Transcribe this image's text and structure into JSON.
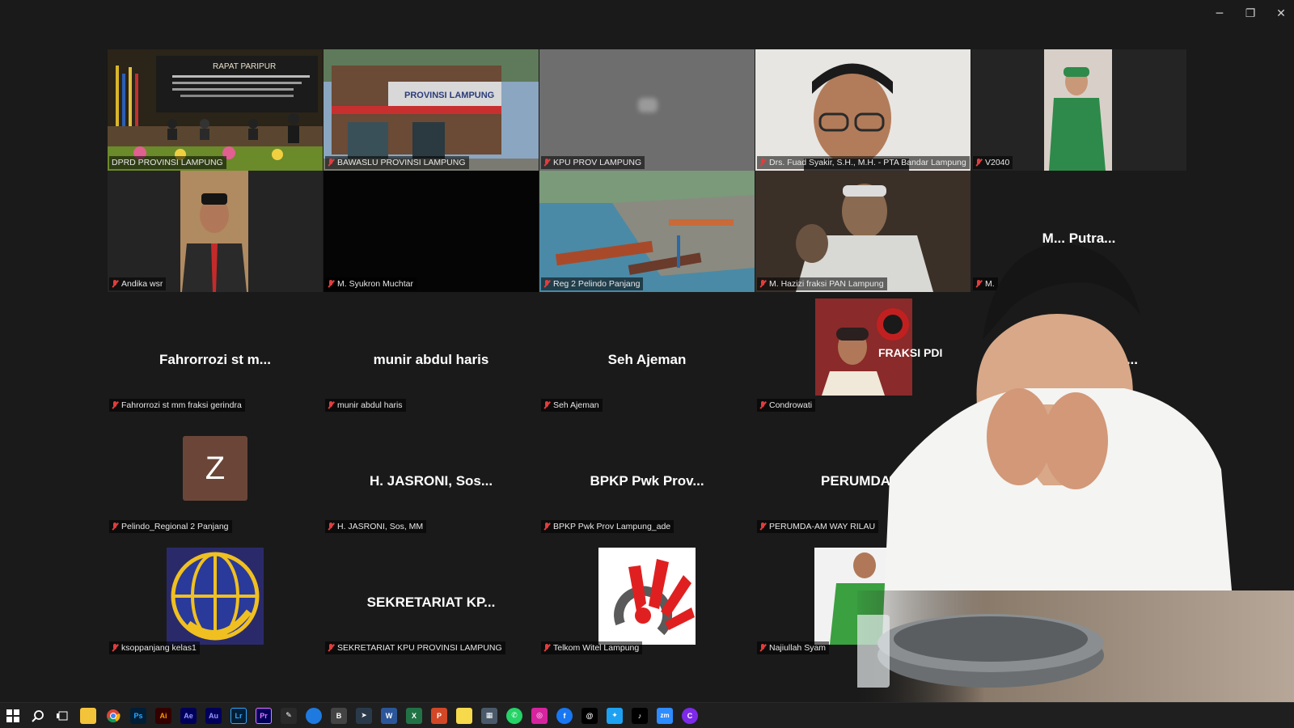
{
  "window": {
    "controls": {
      "minimize": "─",
      "restore": "❐",
      "close": "✕"
    }
  },
  "participants": [
    {
      "label": "DPRD PROVINSI LAMPUNG",
      "type": "video",
      "active": true
    },
    {
      "label": "BAWASLU PROVINSI LAMPUNG",
      "type": "video"
    },
    {
      "label": "KPU PROV LAMPUNG",
      "type": "video"
    },
    {
      "label": "Drs. Fuad Syakir, S.H., M.H. - PTA Bandar Lampung",
      "type": "video"
    },
    {
      "label": "V2040",
      "type": "video"
    },
    {
      "label": "Andika wsr",
      "type": "video"
    },
    {
      "label": "M. Syukron Muchtar",
      "type": "video"
    },
    {
      "label": "Reg 2 Pelindo Panjang",
      "type": "video"
    },
    {
      "label": "M. Hazizi fraksi PAN Lampung",
      "type": "video"
    },
    {
      "label": "M.",
      "bigname": "M... Putra...",
      "type": "name"
    },
    {
      "label": "Fahrorrozi st mm fraksi gerindra",
      "bigname": "Fahrorrozi st m...",
      "type": "name"
    },
    {
      "label": "munir abdul haris",
      "bigname": "munir abdul haris",
      "type": "name"
    },
    {
      "label": "Seh Ajeman",
      "bigname": "Seh Ajeman",
      "type": "name"
    },
    {
      "label": "Condrowati",
      "type": "photo"
    },
    {
      "label": "",
      "bigname": "...",
      "type": "name"
    },
    {
      "label": "Pelindo_Regional 2 Panjang",
      "avatar_letter": "Z",
      "type": "avatar"
    },
    {
      "label": "H. JASRONI, Sos, MM",
      "bigname": "H. JASRONI, Sos...",
      "type": "name"
    },
    {
      "label": "BPKP Pwk Prov Lampung_ade",
      "bigname": "BPKP Pwk Prov...",
      "type": "name"
    },
    {
      "label": "PERUMDA-AM WAY RILAU",
      "bigname": "PERUMDA-A",
      "type": "name"
    },
    {
      "label": "",
      "type": "empty"
    },
    {
      "label": "ksoppanjang kelas1",
      "type": "logo"
    },
    {
      "label": "SEKRETARIAT KPU PROVINSI LAMPUNG",
      "bigname": "SEKRETARIAT KP...",
      "type": "name"
    },
    {
      "label": "Telkom Witel Lampung",
      "type": "logo"
    },
    {
      "label": "Najiullah Syam",
      "type": "photo"
    }
  ],
  "tile_photo_texts": {
    "dprd_banner": "RAPAT PARIPUR",
    "bawaslu_sign": "PROVINSI LAMPUNG",
    "fraksi": "FRAKSI PDI"
  },
  "taskbar": {
    "apps": [
      "start",
      "search",
      "task-view",
      "file-explorer",
      "chrome",
      "photoshop",
      "illustrator",
      "audition-ae",
      "audition",
      "lightroom",
      "premiere",
      "inkscape",
      "edge",
      "app-b",
      "app-arrow",
      "word",
      "excel",
      "powerpoint",
      "sticky-notes",
      "calculator",
      "whatsapp",
      "instagram",
      "facebook",
      "threads",
      "twitter",
      "tiktok",
      "zoom",
      "canva"
    ]
  },
  "colors": {
    "active_border": "#23d96a",
    "mic_muted": "#e23c3c",
    "avatar_bg": "#6b4638"
  }
}
